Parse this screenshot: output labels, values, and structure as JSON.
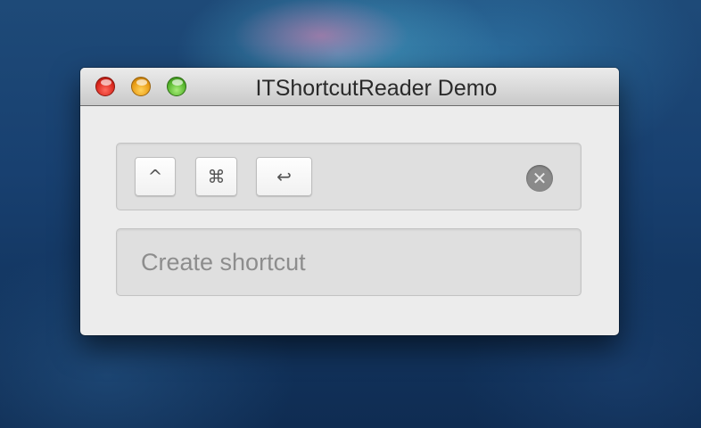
{
  "window": {
    "title": "ITShortcutReader Demo"
  },
  "traffic_lights": {
    "close": "close-button",
    "minimize": "minimize-button",
    "zoom": "zoom-button"
  },
  "shortcut": {
    "keys": [
      {
        "name": "control-key",
        "glyph": "^"
      },
      {
        "name": "command-key",
        "glyph": "⌘"
      },
      {
        "name": "return-key",
        "glyph": "↩"
      }
    ],
    "clear_icon": "clear-icon",
    "clear_glyph": "✕"
  },
  "create": {
    "label": "Create shortcut"
  },
  "colors": {
    "close": "#d9261c",
    "minimize": "#e89b14",
    "zoom": "#55b52c",
    "window_bg": "#ececec",
    "panel_bg": "#dfdfdf"
  }
}
